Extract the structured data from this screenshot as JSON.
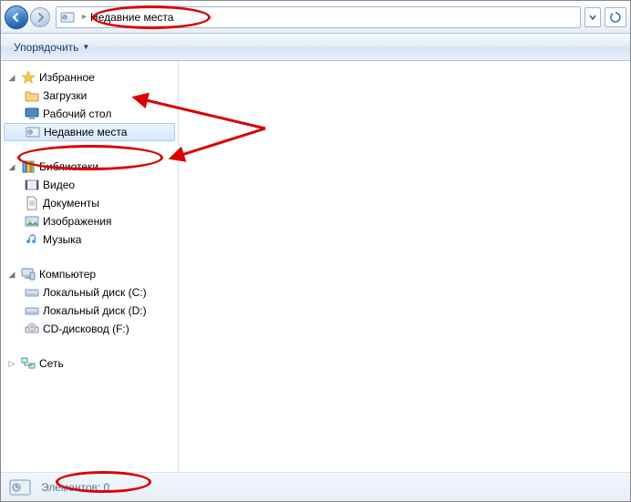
{
  "nav": {
    "address_text": "Недавние места"
  },
  "toolbar": {
    "organize": "Упорядочить"
  },
  "tree": {
    "favorites": {
      "label": "Избранное",
      "items": [
        {
          "label": "Загрузки"
        },
        {
          "label": "Рабочий стол"
        },
        {
          "label": "Недавние места",
          "selected": true
        }
      ]
    },
    "libraries": {
      "label": "Библиотеки",
      "items": [
        {
          "label": "Видео"
        },
        {
          "label": "Документы"
        },
        {
          "label": "Изображения"
        },
        {
          "label": "Музыка"
        }
      ]
    },
    "computer": {
      "label": "Компьютер",
      "items": [
        {
          "label": "Локальный диск (C:)"
        },
        {
          "label": "Локальный диск (D:)"
        },
        {
          "label": "CD-дисковод (F:)"
        }
      ]
    },
    "network": {
      "label": "Сеть"
    }
  },
  "status": {
    "elements_label": "Элементов: 0"
  }
}
